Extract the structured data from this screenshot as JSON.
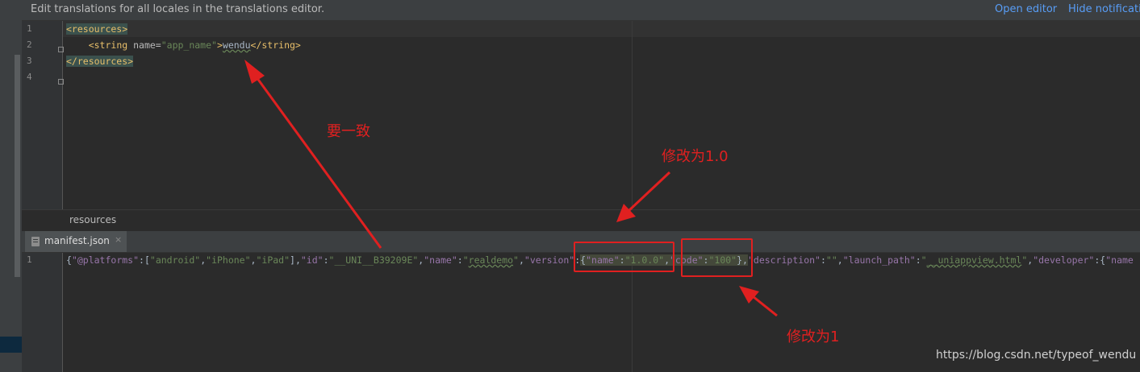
{
  "banner": {
    "message": "Edit translations for all locales in the translations editor.",
    "open_editor": "Open editor",
    "hide_notification": "Hide notificatio"
  },
  "top_editor": {
    "line_numbers": [
      "1",
      "2",
      "3",
      "4"
    ],
    "line1_tag": "<resources>",
    "line2_open": "<string ",
    "line2_attr": "name=",
    "line2_val": "\"app_name\"",
    "line2_gt": ">",
    "line2_text": "wendu",
    "line2_close": "</string>",
    "line3_tag": "</resources>"
  },
  "breadcrumb": "resources",
  "tab": {
    "label": "manifest.json",
    "close": "×",
    "icon": "json-file-icon"
  },
  "bottom_editor": {
    "line_number": "1",
    "json_line": {
      "p1": "{",
      "k1": "\"@platforms\"",
      "p2": ":[",
      "s1": "\"android\"",
      "p3": ",",
      "s2": "\"iPhone\"",
      "p4": ",",
      "s3": "\"iPad\"",
      "p5": "],",
      "k2": "\"id\"",
      "p6": ":",
      "s4": "\"__UNI__B39209E\"",
      "p7": ",",
      "k3": "\"name\"",
      "p8": ":",
      "s5q1": "\"",
      "s5": "realdemo",
      "s5q2": "\"",
      "p9": ",",
      "k4": "\"version\"",
      "p10": ":",
      "p11": "{",
      "k5": "\"name\"",
      "p12": ":",
      "s6": "\"1.0.0\"",
      "p13": ",",
      "k6": "\"code\"",
      "p14": ":",
      "s7": "\"100\"",
      "p15": "},",
      "k7": "\"description\"",
      "p16": ":",
      "s8": "\"\"",
      "p17": ",",
      "k8": "\"launch_path\"",
      "p18": ":",
      "s9q1": "\"",
      "s9": "__uniappview.html",
      "s9q2": "\"",
      "p19": ",",
      "k9": "\"developer\"",
      "p20": ":{",
      "k10": "\"name"
    }
  },
  "annotations": {
    "consistent": "要一致",
    "change_to_10": "修改为1.0",
    "change_to_1": "修改为1"
  },
  "watermark": "https://blog.csdn.net/typeof_wendu",
  "colors": {
    "annotation_red": "#e02020",
    "xml_tag": "#e8bf6a",
    "string": "#6a8759",
    "json_key": "#9876aa"
  }
}
